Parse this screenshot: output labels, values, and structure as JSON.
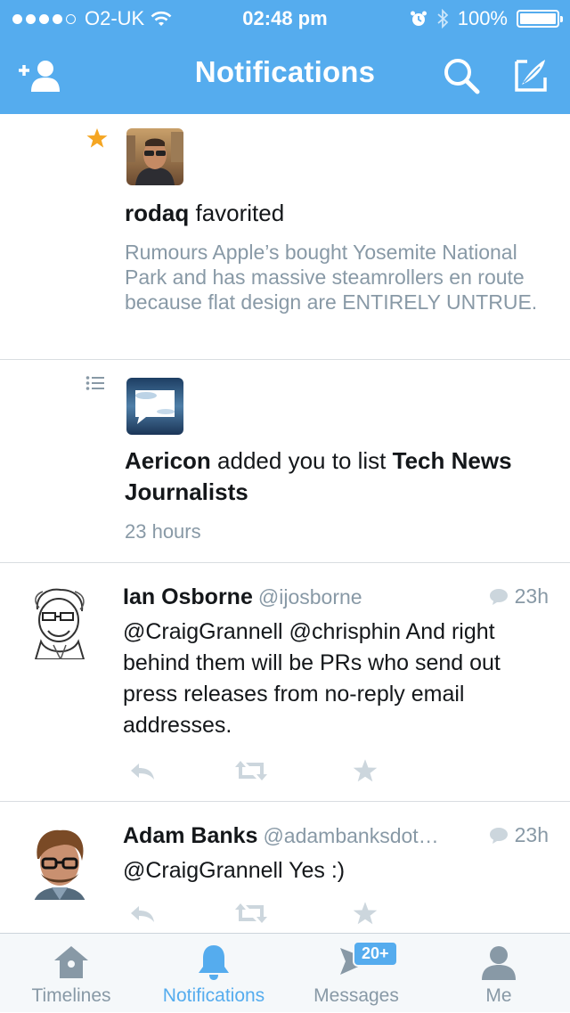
{
  "status_bar": {
    "carrier": "O2-UK",
    "time": "02:48 pm",
    "battery": "100%",
    "signal_bars": 4
  },
  "nav": {
    "title": "Notifications",
    "add_user_icon": "add-user-icon",
    "search_icon": "search-icon",
    "compose_icon": "compose-icon"
  },
  "items": [
    {
      "type": "favorite",
      "user": "rodaq",
      "action": "favorited",
      "quote": "Rumours Apple’s bought Yosemite National Park and has massive steamrollers en route because flat design are ENTIRELY UNTRUE."
    },
    {
      "type": "list",
      "user": "Aericon",
      "action": "added you to list",
      "list_name": "Tech News Journalists",
      "time": "23 hours"
    },
    {
      "type": "tweet",
      "name": "Ian Osborne",
      "handle": "@ijosborne",
      "time": "23h",
      "text": "@CraigGrannell @chrisphin And right behind them will be PRs who send out press releases from no-reply email addresses."
    },
    {
      "type": "tweet",
      "name": "Adam Banks",
      "handle": "@adambanksdot…",
      "time": "23h",
      "text": "@CraigGrannell Yes :)"
    }
  ],
  "tabs": [
    {
      "label": "Timelines",
      "icon": "home-icon"
    },
    {
      "label": "Notifications",
      "icon": "bell-icon",
      "active": true
    },
    {
      "label": "Messages",
      "icon": "messages-icon",
      "badge": "20+"
    },
    {
      "label": "Me",
      "icon": "person-icon"
    }
  ],
  "colors": {
    "brand": "#55acee",
    "muted": "#8899a6",
    "favorite": "#f5a623"
  }
}
